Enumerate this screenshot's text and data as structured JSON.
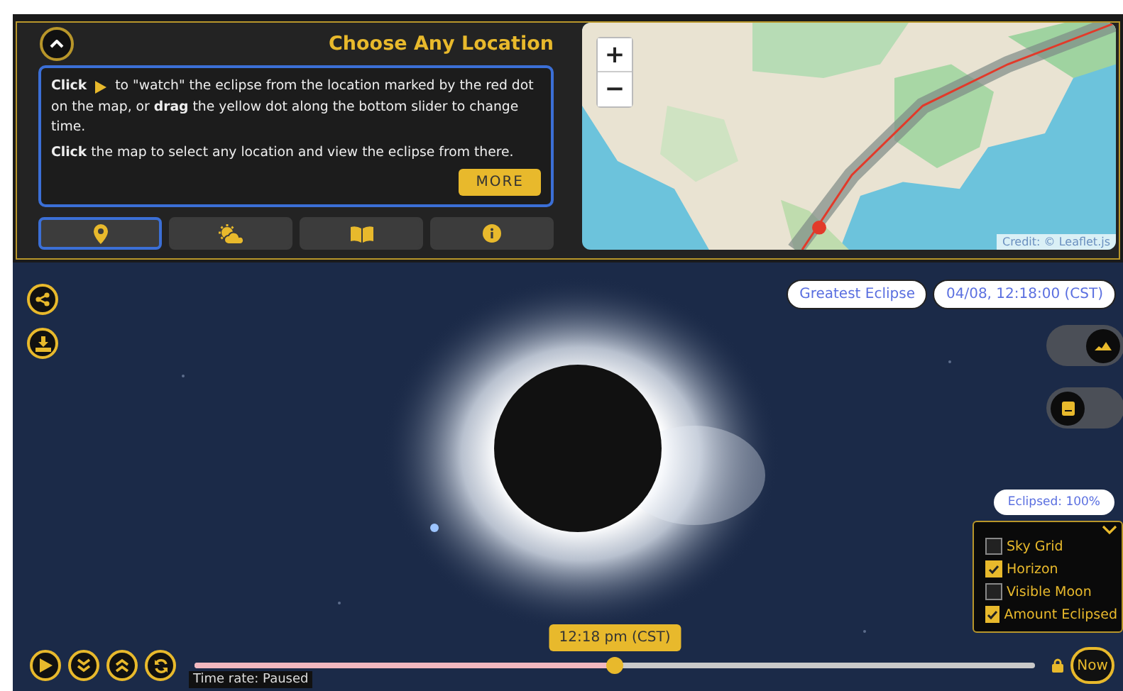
{
  "panel": {
    "title": "Choose Any Location",
    "instructions": {
      "lead": "**Click**",
      "after_icon": "to \"watch\" the eclipse from the location marked by the red dot",
      "continued": "on the map, or **drag** the yellow dot along the bottom slider to change time.",
      "second": "**Click** the map to select any location and view the eclipse from there."
    },
    "more_button": "MORE",
    "tabs": [
      {
        "kind": "pin",
        "selected": true
      },
      {
        "kind": "weather",
        "selected": false
      },
      {
        "kind": "book",
        "selected": false
      },
      {
        "kind": "info",
        "selected": false
      }
    ]
  },
  "map": {
    "zoom_in": "+",
    "zoom_out": "−",
    "credit": "Credit: © Leaflet.js"
  },
  "sky": {
    "badges": [
      "Greatest Eclipse",
      "04/08, 12:18:00 (CST)"
    ],
    "side_buttons": [
      {
        "kind": "share"
      },
      {
        "kind": "tray"
      }
    ],
    "toggles": [
      {
        "kind": "horizon",
        "on": true
      },
      {
        "kind": "moon",
        "on": false
      }
    ],
    "eclipsed": "Eclipsed: 100%",
    "options": [
      {
        "label": "Sky Grid",
        "checked": false
      },
      {
        "label": "Horizon",
        "checked": true
      },
      {
        "label": "Visible Moon",
        "checked": false
      },
      {
        "label": "Amount Eclipsed",
        "checked": true
      }
    ],
    "playback_buttons": [
      {
        "kind": "play"
      },
      {
        "kind": "slower"
      },
      {
        "kind": "faster"
      },
      {
        "kind": "reset"
      }
    ],
    "time_tooltip": "12:18 pm (CST)",
    "slider": {
      "level": 0.5
    },
    "time_rate": "Time rate: Paused",
    "now_button": "Now"
  }
}
